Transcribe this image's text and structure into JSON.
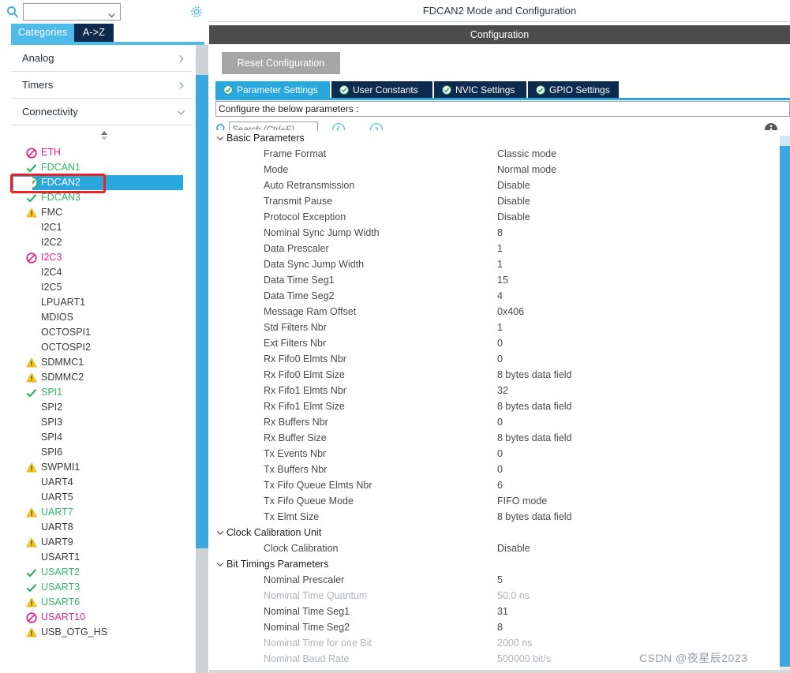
{
  "left_panel": {
    "search": {
      "value": "",
      "placeholder": ""
    },
    "icons": {
      "search": "search-icon",
      "gear": "gear-icon",
      "caret": "chevron-down-icon",
      "sort": "sort-updown-icon"
    },
    "tabs": [
      {
        "label": "Categories",
        "active": true
      },
      {
        "label": "A->Z",
        "active": false
      }
    ],
    "categories": [
      {
        "label": "Analog",
        "expanded": false,
        "arrow": "chevron-right-icon"
      },
      {
        "label": "Timers",
        "expanded": false,
        "arrow": "chevron-right-icon"
      },
      {
        "label": "Connectivity",
        "expanded": true,
        "arrow": "chevron-down-icon"
      }
    ],
    "peripherals": [
      {
        "label": "ETH",
        "status": "forbidden",
        "selected": false
      },
      {
        "label": "FDCAN1",
        "status": "check",
        "selected": false
      },
      {
        "label": "FDCAN2",
        "status": "check-filled",
        "selected": true
      },
      {
        "label": "FDCAN3",
        "status": "check",
        "selected": false
      },
      {
        "label": "FMC",
        "status": "warning",
        "selected": false
      },
      {
        "label": "I2C1",
        "status": "none",
        "selected": false
      },
      {
        "label": "I2C2",
        "status": "none",
        "selected": false
      },
      {
        "label": "I2C3",
        "status": "forbidden",
        "selected": false
      },
      {
        "label": "I2C4",
        "status": "none",
        "selected": false
      },
      {
        "label": "I2C5",
        "status": "none",
        "selected": false
      },
      {
        "label": "LPUART1",
        "status": "none",
        "selected": false
      },
      {
        "label": "MDIOS",
        "status": "none",
        "selected": false
      },
      {
        "label": "OCTOSPI1",
        "status": "none",
        "selected": false
      },
      {
        "label": "OCTOSPI2",
        "status": "none",
        "selected": false
      },
      {
        "label": "SDMMC1",
        "status": "warning",
        "selected": false
      },
      {
        "label": "SDMMC2",
        "status": "warning",
        "selected": false
      },
      {
        "label": "SPI1",
        "status": "check",
        "selected": false
      },
      {
        "label": "SPI2",
        "status": "none",
        "selected": false
      },
      {
        "label": "SPI3",
        "status": "none",
        "selected": false
      },
      {
        "label": "SPI4",
        "status": "none",
        "selected": false
      },
      {
        "label": "SPI6",
        "status": "none",
        "selected": false
      },
      {
        "label": "SWPMI1",
        "status": "warning",
        "selected": false
      },
      {
        "label": "UART4",
        "status": "none",
        "selected": false
      },
      {
        "label": "UART5",
        "status": "none",
        "selected": false
      },
      {
        "label": "UART7",
        "status": "warning",
        "selected": false,
        "text_green": true
      },
      {
        "label": "UART8",
        "status": "none",
        "selected": false
      },
      {
        "label": "UART9",
        "status": "warning",
        "selected": false
      },
      {
        "label": "USART1",
        "status": "none",
        "selected": false
      },
      {
        "label": "USART2",
        "status": "check",
        "selected": false
      },
      {
        "label": "USART3",
        "status": "check",
        "selected": false
      },
      {
        "label": "USART6",
        "status": "warning",
        "selected": false,
        "text_green": true
      },
      {
        "label": "USART10",
        "status": "forbidden",
        "selected": false
      },
      {
        "label": "USB_OTG_HS",
        "status": "warning",
        "selected": false
      }
    ]
  },
  "right_panel": {
    "mode_title": "FDCAN2 Mode and Configuration",
    "configuration_header": "Configuration",
    "reset_button": "Reset Configuration",
    "tabs": [
      {
        "label": "Parameter Settings",
        "active": true,
        "icon": "check-circle-icon"
      },
      {
        "label": "User Constants",
        "active": false,
        "icon": "check-circle-icon"
      },
      {
        "label": "NVIC Settings",
        "active": false,
        "icon": "check-circle-icon"
      },
      {
        "label": "GPIO Settings",
        "active": false,
        "icon": "check-circle-icon"
      }
    ],
    "configure_hint": "Configure the below parameters :",
    "param_search": {
      "value": "",
      "placeholder": "Search (Ctrl+F)"
    },
    "nav": {
      "prev": "chevron-left-circle-icon",
      "next": "chevron-right-circle-icon",
      "info": "info-icon"
    },
    "parameter_groups": [
      {
        "name": "Basic Parameters",
        "expanded": true,
        "rows": [
          {
            "name": "Frame Format",
            "value": "Classic mode",
            "dim": false
          },
          {
            "name": "Mode",
            "value": "Normal mode",
            "dim": false
          },
          {
            "name": "Auto Retransmission",
            "value": "Disable",
            "dim": false
          },
          {
            "name": "Transmit Pause",
            "value": "Disable",
            "dim": false
          },
          {
            "name": "Protocol Exception",
            "value": "Disable",
            "dim": false
          },
          {
            "name": "Nominal Sync Jump Width",
            "value": "8",
            "dim": false
          },
          {
            "name": "Data Prescaler",
            "value": "1",
            "dim": false
          },
          {
            "name": "Data Sync Jump Width",
            "value": "1",
            "dim": false
          },
          {
            "name": "Data Time Seg1",
            "value": "15",
            "dim": false
          },
          {
            "name": "Data Time Seg2",
            "value": "4",
            "dim": false
          },
          {
            "name": "Message Ram Offset",
            "value": "0x406",
            "dim": false
          },
          {
            "name": "Std Filters Nbr",
            "value": "1",
            "dim": false
          },
          {
            "name": "Ext Filters Nbr",
            "value": "0",
            "dim": false
          },
          {
            "name": "Rx Fifo0 Elmts Nbr",
            "value": "0",
            "dim": false
          },
          {
            "name": "Rx Fifo0 Elmt Size",
            "value": "8 bytes data field",
            "dim": false
          },
          {
            "name": "Rx Fifo1 Elmts Nbr",
            "value": "32",
            "dim": false
          },
          {
            "name": "Rx Fifo1 Elmt Size",
            "value": "8 bytes data field",
            "dim": false
          },
          {
            "name": "Rx Buffers Nbr",
            "value": "0",
            "dim": false
          },
          {
            "name": "Rx Buffer Size",
            "value": "8 bytes data field",
            "dim": false
          },
          {
            "name": "Tx Events Nbr",
            "value": "0",
            "dim": false
          },
          {
            "name": "Tx Buffers Nbr",
            "value": "0",
            "dim": false
          },
          {
            "name": "Tx Fifo Queue Elmts Nbr",
            "value": "6",
            "dim": false
          },
          {
            "name": "Tx Fifo Queue Mode",
            "value": "FIFO mode",
            "dim": false
          },
          {
            "name": "Tx Elmt Size",
            "value": "8 bytes data field",
            "dim": false
          }
        ]
      },
      {
        "name": "Clock Calibration Unit",
        "expanded": true,
        "rows": [
          {
            "name": "Clock Calibration",
            "value": "Disable",
            "dim": false
          }
        ]
      },
      {
        "name": "Bit Timings Parameters",
        "expanded": true,
        "rows": [
          {
            "name": "Nominal Prescaler",
            "value": "5",
            "dim": false
          },
          {
            "name": "Nominal Time Quantum",
            "value": "50.0 ns",
            "dim": true
          },
          {
            "name": "Nominal Time Seg1",
            "value": "31",
            "dim": false
          },
          {
            "name": "Nominal Time Seg2",
            "value": "8",
            "dim": false
          },
          {
            "name": "Nominal Time for one Bit",
            "value": "2000 ns",
            "dim": true
          },
          {
            "name": "Nominal Baud Rate",
            "value": "500000 bit/s",
            "dim": true
          }
        ]
      }
    ]
  },
  "watermark": "CSDN @夜星辰2023",
  "colors": {
    "accent_blue": "#29a8dd",
    "tab_dark": "#0d2b4e",
    "header_grey": "#4c4c4c",
    "status_green": "#35b66b",
    "status_warning": "#f5c518",
    "status_forbidden": "#e8228b",
    "annotation_red": "#ee2222"
  }
}
